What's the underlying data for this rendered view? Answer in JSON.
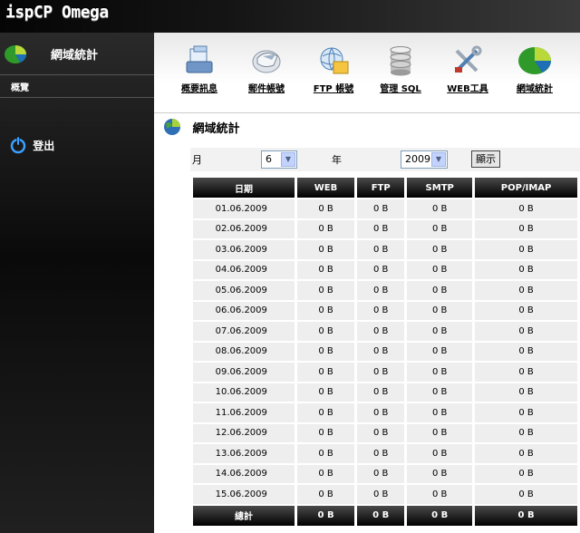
{
  "app": {
    "logo": "ispCP Omega"
  },
  "sidebar": {
    "title": "網域統計",
    "subtitle": "概覽",
    "logout": "登出"
  },
  "toolbar": [
    {
      "label": "概要訊息",
      "icon": "overview-icon"
    },
    {
      "label": "郵件帳號",
      "icon": "mail-icon"
    },
    {
      "label": "FTP 帳號",
      "icon": "ftp-icon"
    },
    {
      "label": "管理 SQL",
      "icon": "database-icon"
    },
    {
      "label": "WEB工具",
      "icon": "tools-icon"
    },
    {
      "label": "網域統計",
      "icon": "pie-chart-icon"
    }
  ],
  "section": {
    "title": "網域統計"
  },
  "filter": {
    "month_label": "月",
    "month_value": "6",
    "year_label": "年",
    "year_value": "2009",
    "show_button": "顯示"
  },
  "table": {
    "headers": [
      "日期",
      "WEB",
      "FTP",
      "SMTP",
      "POP/IMAP"
    ],
    "rows": [
      [
        "01.06.2009",
        "0 B",
        "0 B",
        "0 B",
        "0 B"
      ],
      [
        "02.06.2009",
        "0 B",
        "0 B",
        "0 B",
        "0 B"
      ],
      [
        "03.06.2009",
        "0 B",
        "0 B",
        "0 B",
        "0 B"
      ],
      [
        "04.06.2009",
        "0 B",
        "0 B",
        "0 B",
        "0 B"
      ],
      [
        "05.06.2009",
        "0 B",
        "0 B",
        "0 B",
        "0 B"
      ],
      [
        "06.06.2009",
        "0 B",
        "0 B",
        "0 B",
        "0 B"
      ],
      [
        "07.06.2009",
        "0 B",
        "0 B",
        "0 B",
        "0 B"
      ],
      [
        "08.06.2009",
        "0 B",
        "0 B",
        "0 B",
        "0 B"
      ],
      [
        "09.06.2009",
        "0 B",
        "0 B",
        "0 B",
        "0 B"
      ],
      [
        "10.06.2009",
        "0 B",
        "0 B",
        "0 B",
        "0 B"
      ],
      [
        "11.06.2009",
        "0 B",
        "0 B",
        "0 B",
        "0 B"
      ],
      [
        "12.06.2009",
        "0 B",
        "0 B",
        "0 B",
        "0 B"
      ],
      [
        "13.06.2009",
        "0 B",
        "0 B",
        "0 B",
        "0 B"
      ],
      [
        "14.06.2009",
        "0 B",
        "0 B",
        "0 B",
        "0 B"
      ],
      [
        "15.06.2009",
        "0 B",
        "0 B",
        "0 B",
        "0 B"
      ]
    ],
    "total": [
      "總計",
      "0 B",
      "0 B",
      "0 B",
      "0 B"
    ]
  }
}
